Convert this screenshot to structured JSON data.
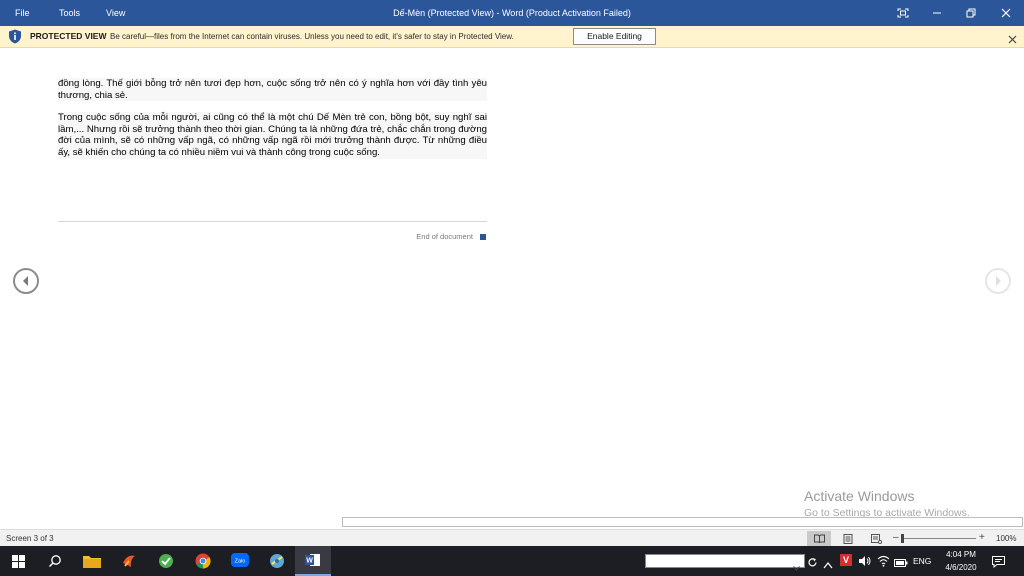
{
  "titlebar": {
    "menu": [
      "File",
      "Tools",
      "View"
    ],
    "title": "Dế-Mèn (Protected View) - Word (Product Activation Failed)",
    "bg_color": "#2b579a"
  },
  "protected_view": {
    "title": "PROTECTED VIEW",
    "message": "Be careful—files from the Internet can contain viruses. Unless you need to edit, it's safer to stay in Protected View.",
    "button": "Enable Editing",
    "bg_color": "#fff4ce"
  },
  "document": {
    "paragraphs": [
      "đồng lòng. Thế giới bỗng trở nên tươi đẹp hơn, cuộc sống trở nên có ý nghĩa hơn với đầy tình yêu thương, chia sẻ.",
      "Trong cuộc sống của mỗi người, ai cũng có thể là một chú Dế Mèn trẻ con, bồng bột, suy nghĩ sai lầm,... Nhưng rồi sẽ trưởng thành theo thời gian. Chúng ta là những đứa trẻ, chắc chắn trong đường đời của mình, sẽ có những vấp ngã, có những vấp ngã rồi mới trưởng thành được. Từ những điều ấy, sẽ khiến cho chúng ta có nhiều niềm vui và thành công trong cuộc sống."
    ],
    "end_label": "End of document"
  },
  "watermark": {
    "line1": "Activate Windows",
    "line2": "Go to Settings to activate Windows."
  },
  "statusbar": {
    "screen": "Screen 3 of 3",
    "zoom": "100%"
  },
  "taskbar": {
    "language": "ENG",
    "time": "4:04 PM",
    "date": "4/6/2020",
    "apps": [
      "file-explorer-icon",
      "app-icon",
      "app-icon",
      "chrome-icon",
      "zalo-icon",
      "app-icon",
      "word-icon"
    ]
  }
}
